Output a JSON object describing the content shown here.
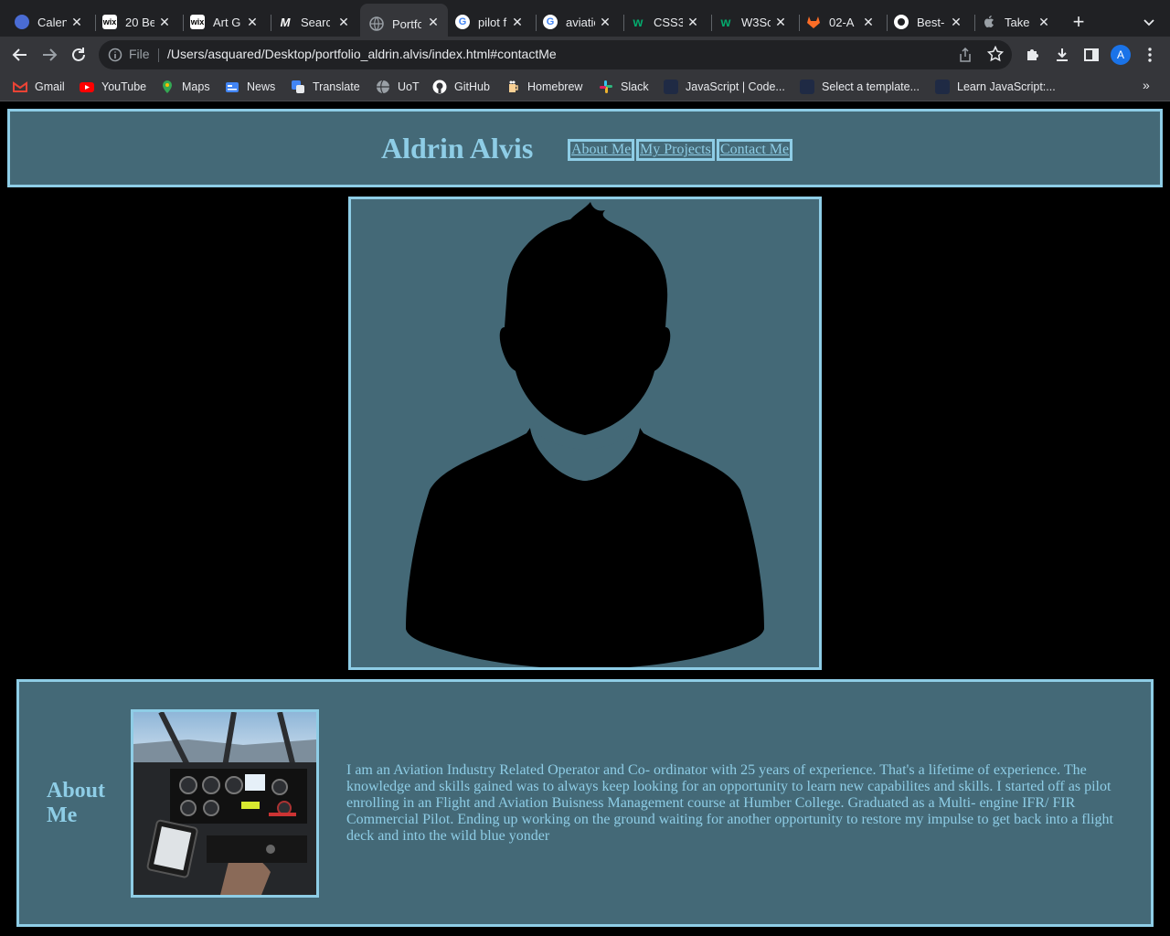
{
  "browser": {
    "tabs": [
      {
        "title": "Calen",
        "icon": "calendar-icon",
        "color": "#4a6cd4"
      },
      {
        "title": "20 Be",
        "icon": "wix-icon",
        "color": "#ffffff"
      },
      {
        "title": "Art G",
        "icon": "wix-icon",
        "color": "#ffffff"
      },
      {
        "title": "Searc",
        "icon": "medium-icon",
        "color": "#ffffff"
      },
      {
        "title": "Portfo",
        "icon": "globe-icon",
        "color": "#9aa0a6",
        "active": true
      },
      {
        "title": "pilot f",
        "icon": "google-icon",
        "color": "#4285f4"
      },
      {
        "title": "aviatio",
        "icon": "google-icon",
        "color": "#4285f4"
      },
      {
        "title": "CSS3",
        "icon": "w3schools-icon",
        "color": "#04aa6d"
      },
      {
        "title": "W3Sc",
        "icon": "w3schools-icon",
        "color": "#04aa6d"
      },
      {
        "title": "02-A",
        "icon": "gitlab-icon",
        "color": "#fc6d26"
      },
      {
        "title": "Best-",
        "icon": "github-icon",
        "color": "#ffffff"
      },
      {
        "title": "Take",
        "icon": "apple-icon",
        "color": "#9aa0a6"
      }
    ],
    "omnibox": {
      "scheme_label": "File",
      "url": "/Users/asquared/Desktop/portfolio_aldrin.alvis/index.html#contactMe"
    },
    "profile_initial": "A",
    "bookmarks": [
      {
        "label": "Gmail",
        "icon": "gmail-icon",
        "color": "#ea4335"
      },
      {
        "label": "YouTube",
        "icon": "youtube-icon",
        "color": "#ff0000"
      },
      {
        "label": "Maps",
        "icon": "maps-icon",
        "color": "#34a853"
      },
      {
        "label": "News",
        "icon": "news-icon",
        "color": "#4285f4"
      },
      {
        "label": "Translate",
        "icon": "translate-icon",
        "color": "#4285f4"
      },
      {
        "label": "UoT",
        "icon": "globe-icon",
        "color": "#9aa0a6"
      },
      {
        "label": "GitHub",
        "icon": "github-icon",
        "color": "#ffffff"
      },
      {
        "label": "Homebrew",
        "icon": "homebrew-icon",
        "color": "#f9d094"
      },
      {
        "label": "Slack",
        "icon": "slack-icon",
        "color": "#36c5f0"
      },
      {
        "label": "JavaScript | Code...",
        "icon": "codecademy-icon",
        "color": "#1f2a44"
      },
      {
        "label": "Select a template...",
        "icon": "template-icon",
        "color": "#1f2a44"
      },
      {
        "label": "Learn JavaScript:...",
        "icon": "codecademy-icon",
        "color": "#1f2a44"
      }
    ],
    "bookmarks_overflow": "»"
  },
  "site": {
    "title": "Aldrin Alvis",
    "nav": [
      "About Me",
      "My Projects",
      "Contact Me"
    ],
    "about_heading": "About Me",
    "about_text": "I am an Aviation Industry Related Operator and Co- ordinator with 25 years of experience. That's a lifetime of experience. The knowledge and skills gained was to always keep looking for an opportunity to learn new capabilites and skills. I started off as pilot enrolling in an Flight and Aviation Buisness Management course at Humber College. Graduated as a Multi- engine IFR/ FIR Commercial Pilot. Ending up working on the ground waiting for another opportunity to restore my impulse to get back into a flight deck and into the wild blue yonder"
  },
  "colors": {
    "panel_bg": "#446977",
    "accent": "#8ecde6",
    "page_bg": "#000000"
  }
}
